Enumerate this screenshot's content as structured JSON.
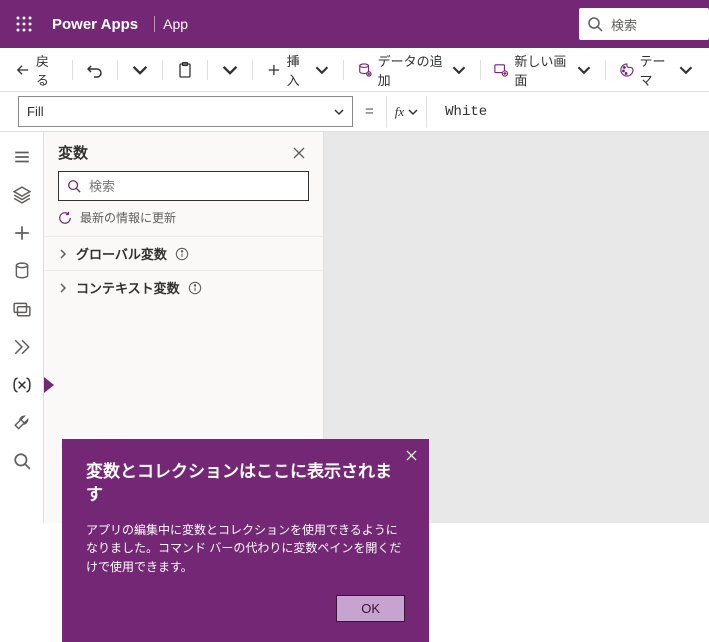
{
  "topbar": {
    "product": "Power Apps",
    "app_name": "App",
    "search_placeholder": "検索"
  },
  "cmdbar": {
    "back": "戻る",
    "insert": "挿入",
    "add_data": "データの追加",
    "new_screen": "新しい画面",
    "theme": "テーマ"
  },
  "formulabar": {
    "property": "Fill",
    "fx_label": "fx",
    "value": "White"
  },
  "vars_panel": {
    "title": "変数",
    "search_placeholder": "検索",
    "refresh_label": "最新の情報に更新",
    "groups": [
      {
        "label": "グローバル変数"
      },
      {
        "label": "コンテキスト変数"
      }
    ]
  },
  "callout": {
    "title": "変数とコレクションはここに表示されます",
    "body": "アプリの編集中に変数とコレクションを使用できるようになりました。コマンド バーの代わりに変数ペインを開くだけで使用できます。",
    "ok": "OK"
  }
}
